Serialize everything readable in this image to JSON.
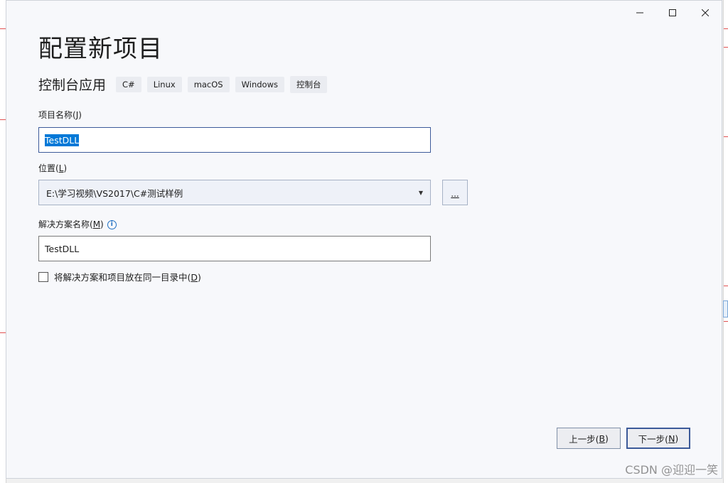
{
  "dialog": {
    "title": "配置新项目",
    "subtitle": "控制台应用",
    "tags": [
      "C#",
      "Linux",
      "macOS",
      "Windows",
      "控制台"
    ]
  },
  "fields": {
    "project_name": {
      "label_text": "项目名称(",
      "label_key": "J",
      "label_end": ")",
      "value": "TestDLL"
    },
    "location": {
      "label_text": "位置(",
      "label_key": "L",
      "label_end": ")",
      "value": "E:\\学习视频\\VS2017\\C#测试样例",
      "browse_label": "..."
    },
    "solution_name": {
      "label_text": "解决方案名称(",
      "label_key": "M",
      "label_end": ")",
      "value": "TestDLL",
      "info_glyph": "i"
    },
    "same_dir": {
      "label_text": "将解决方案和项目放在同一目录中(",
      "label_key": "D",
      "label_end": ")",
      "checked": false
    }
  },
  "buttons": {
    "back": {
      "text": "上一步(",
      "key": "B",
      "end": ")"
    },
    "next": {
      "text": "下一步(",
      "key": "N",
      "end": ")"
    }
  },
  "watermark": "CSDN @迎迎一笑",
  "colors": {
    "selection": "#0078d7",
    "focus_border": "#3c5a99",
    "info_blue": "#1f6fc2"
  }
}
